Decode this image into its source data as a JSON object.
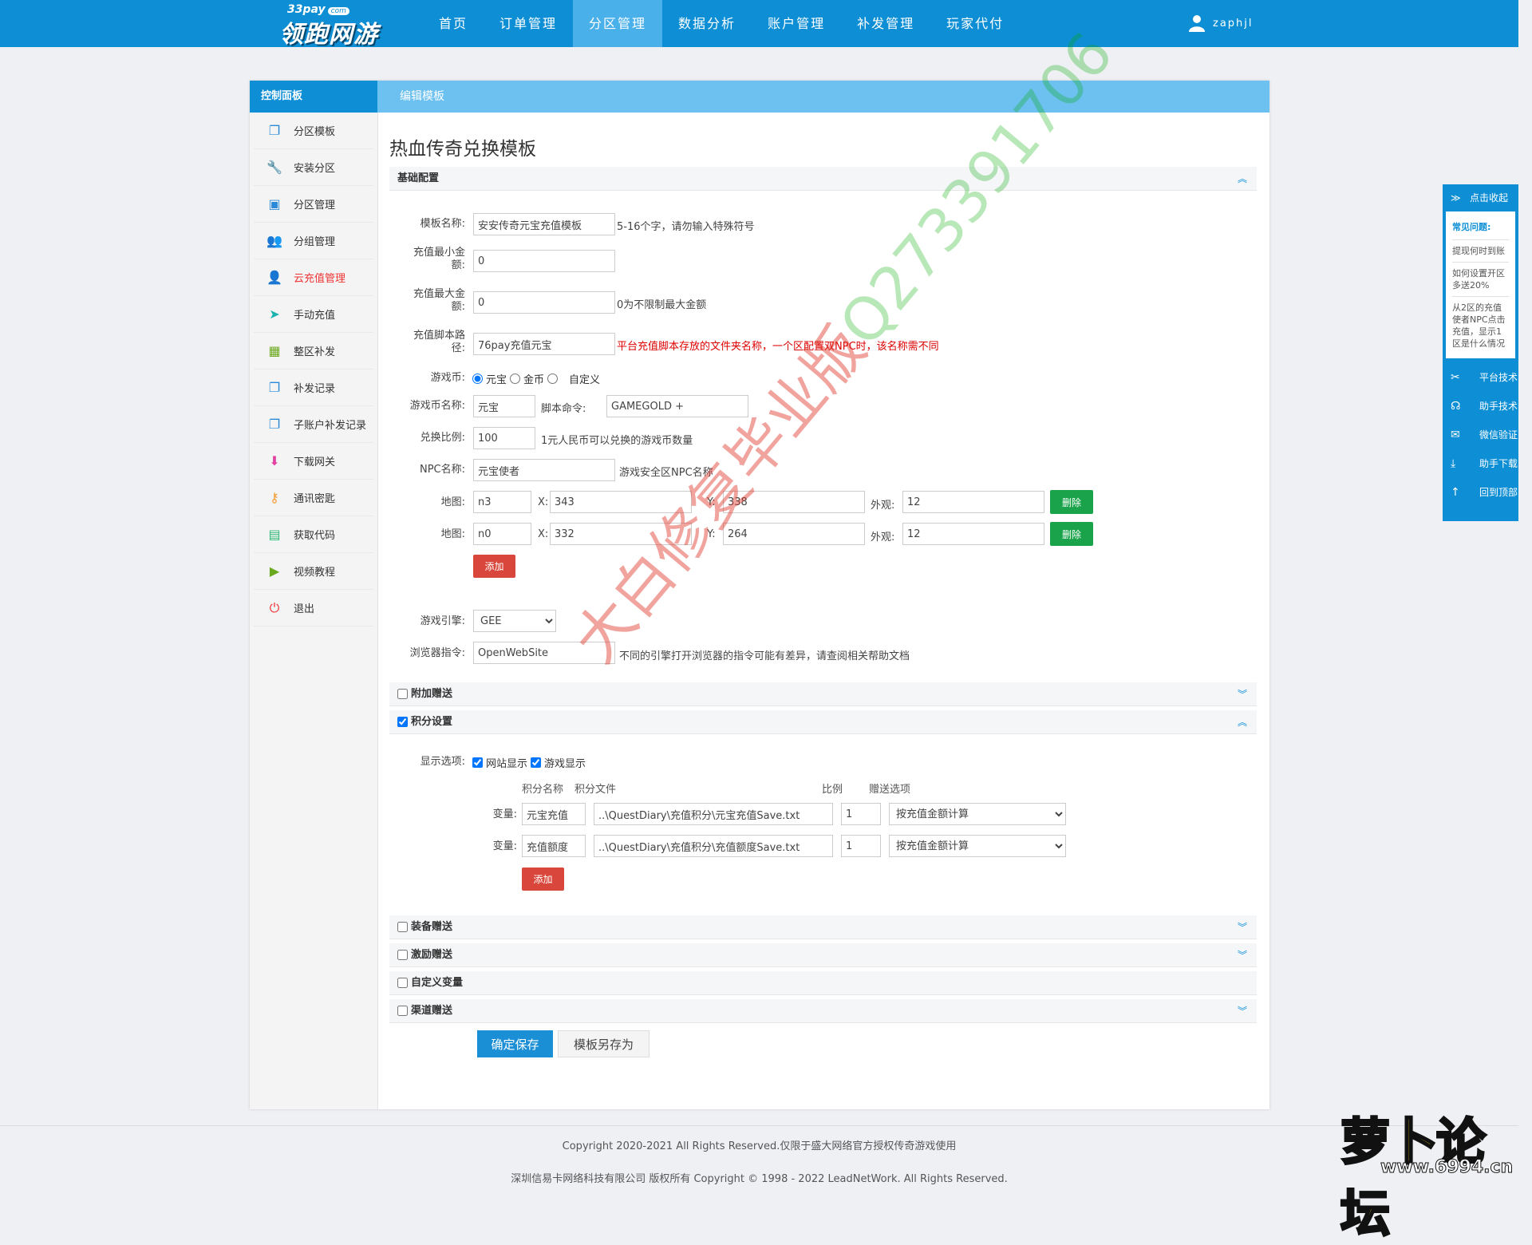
{
  "header": {
    "logo_small": "33pay",
    "logo_com": "com",
    "logo_big": "领跑网游",
    "nav": [
      {
        "label": "首页",
        "active": false
      },
      {
        "label": "订单管理",
        "active": false
      },
      {
        "label": "分区管理",
        "active": true
      },
      {
        "label": "数据分析",
        "active": false
      },
      {
        "label": "账户管理",
        "active": false
      },
      {
        "label": "补发管理",
        "active": false
      },
      {
        "label": "玩家代付",
        "active": false
      }
    ],
    "username": "zaphjl"
  },
  "sidebar": {
    "title": "控制面板",
    "items": [
      {
        "label": "分区模板",
        "icon": "copy-icon"
      },
      {
        "label": "安装分区",
        "icon": "wrench-icon"
      },
      {
        "label": "分区管理",
        "icon": "inbox-icon"
      },
      {
        "label": "分组管理",
        "icon": "users-icon"
      },
      {
        "label": "云充值管理",
        "icon": "user-icon",
        "active": true
      },
      {
        "label": "手动充值",
        "icon": "send-icon"
      },
      {
        "label": "整区补发",
        "icon": "calendar-icon"
      },
      {
        "label": "补发记录",
        "icon": "copy-icon"
      },
      {
        "label": "子账户补发记录",
        "icon": "copy-icon"
      },
      {
        "label": "下载网关",
        "icon": "download-icon"
      },
      {
        "label": "通讯密匙",
        "icon": "key-icon"
      },
      {
        "label": "获取代码",
        "icon": "briefcase-icon"
      },
      {
        "label": "视频教程",
        "icon": "video-icon"
      },
      {
        "label": "退出",
        "icon": "power-icon"
      }
    ]
  },
  "main": {
    "breadcrumb": "编辑模板",
    "page_title": "热血传奇兑换模板",
    "sections": {
      "basic": "基础配置",
      "extra_gift": "附加赠送",
      "points": "积分设置",
      "equip_gift": "装备赠送",
      "incentive_gift": "激励赠送",
      "custom_var": "自定义变量",
      "channel_gift": "渠道赠送"
    },
    "form": {
      "tpl_name_label": "模板名称:",
      "tpl_name_value": "安安传奇元宝充值模板",
      "tpl_name_hint": "5-16个字，请勿输入特殊符号",
      "min_label_1": "充值最小金",
      "min_label_2": "额:",
      "min_value": "0",
      "max_label_1": "充值最大金",
      "max_label_2": "额:",
      "max_value": "0",
      "max_hint": "0为不限制最大金额",
      "script_label_1": "充值脚本路",
      "script_label_2": "径:",
      "script_value": "76pay充值元宝",
      "script_hint": "平台充值脚本存放的文件夹名称，一个区配置双NPC时，该名称需不同",
      "currency_label": "游戏币:",
      "currency_options": [
        "元宝",
        "金币",
        "自定义"
      ],
      "currency_name_label": "游戏币名称:",
      "currency_name_value": "元宝",
      "script_cmd_label": "脚本命令:",
      "script_cmd_value": "GAMEGOLD +",
      "ratio_label": "兑换比例:",
      "ratio_value": "100",
      "ratio_hint": "1元人民币可以兑换的游戏币数量",
      "npc_label": "NPC名称:",
      "npc_value": "元宝使者",
      "npc_hint": "游戏安全区NPC名称",
      "maps": [
        {
          "label": "地图:",
          "map": "n3",
          "x": "343",
          "y": "338",
          "look": "12"
        },
        {
          "label": "地图:",
          "map": "n0",
          "x": "332",
          "y": "264",
          "look": "12"
        }
      ],
      "x_label": "X:",
      "y_label": "Y:",
      "look_label": "外观:",
      "delete_label": "删除",
      "add_label": "添加",
      "engine_label": "游戏引擎:",
      "engine_value": "GEE",
      "browser_label": "浏览器指令:",
      "browser_value": "OpenWebSite",
      "browser_hint": "不同的引擎打开浏览器的指令可能有差异，请查阅相关帮助文档"
    },
    "points": {
      "display_label": "显示选项:",
      "display_options": [
        "网站显示",
        "游戏显示"
      ],
      "col_name": "积分名称",
      "col_file": "积分文件",
      "col_ratio": "比例",
      "col_gift": "赠送选项",
      "rows": [
        {
          "label": "变量:",
          "name": "元宝充值",
          "file": "..\\QuestDiary\\充值积分\\元宝充值Save.txt",
          "ratio": "1",
          "gift": "按充值金额计算"
        },
        {
          "label": "变量:",
          "name": "充值额度",
          "file": "..\\QuestDiary\\充值积分\\充值额度Save.txt",
          "ratio": "1",
          "gift": "按充值金额计算"
        }
      ],
      "add_label": "添加"
    },
    "save_label": "确定保存",
    "save_as_label": "模板另存为"
  },
  "float_panel": {
    "collapse": "点击收起",
    "faq_title": "常见问题:",
    "faqs": [
      "提现何时到账",
      "如何设置开区多送20%",
      "从2区的充值使者NPC点击充值，显示1区是什么情况"
    ],
    "links": [
      "平台技术",
      "助手技术",
      "微信验证",
      "助手下载",
      "回到顶部"
    ]
  },
  "watermark": {
    "red": "大白修复毕业版",
    "green": "Q2733917​06"
  },
  "footer": {
    "line1": "Copyright 2020-2021 All Rights Reserved.仅限于盛大网络官方授权传奇游戏使用",
    "line2": "深圳信易卡网络科技有限公司 版权所有 Copyright © 1998 - 2022 LeadNetWork. All Rights Reserved."
  },
  "badge": {
    "title": "萝卜论坛",
    "url": "www.6994.cn"
  },
  "colors": {
    "brand": "#0e8fd5",
    "danger": "#d9463b",
    "success": "#1aa34a"
  }
}
